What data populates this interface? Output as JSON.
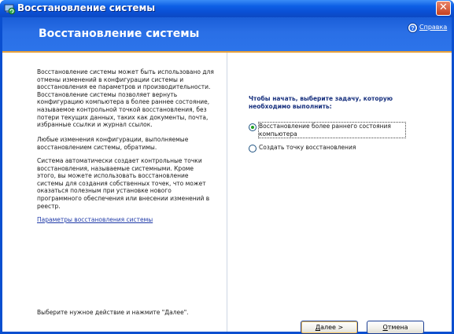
{
  "window": {
    "title": "Восстановление системы",
    "close_label": "✕"
  },
  "header": {
    "title": "Восстановление системы",
    "help_label": "Справка",
    "help_icon": "help-icon"
  },
  "left": {
    "paragraph1": "Восстановление системы может быть использовано для отмены изменений в конфигурации системы и восстановления ее параметров и производительности. Восстановление системы позволяет вернуть конфигурацию компьютера в более раннее состояние, называемое контрольной точкой восстановления, без потери текущих данных, таких как документы, почта, избранные ссылки и журнал ссылок.",
    "paragraph2": "Любые изменения конфигурации, выполняемые восстановлением системы, обратимы.",
    "paragraph3": "Система автоматически создает контрольные точки восстановления, называемые системными. Кроме этого, вы можете использовать восстановление системы для создания собственных точек, что может оказаться полезным при установке нового программного обеспечения или внесении изменений в реестр.",
    "settings_link": "Параметры восстановления системы",
    "hint": "Выберите нужное действие и нажмите \"Далее\"."
  },
  "right": {
    "task_heading": "Чтобы начать, выберите задачу, которую необходимо выполнить:",
    "options": [
      {
        "label": "Восстановление более раннего состояния компьютера",
        "selected": true
      },
      {
        "label": "Создать точку восстановления",
        "selected": false
      }
    ]
  },
  "buttons": {
    "next_prefix": "",
    "next_underlined": "Д",
    "next_rest": "алее >",
    "cancel_underlined": "О",
    "cancel_rest": "тмена"
  },
  "colors": {
    "titlebar": "#0a4fd0",
    "header": "#2a6fe6",
    "accent_line": "#e9a13a",
    "heading_text": "#17307e",
    "link": "#1f3aa8"
  }
}
